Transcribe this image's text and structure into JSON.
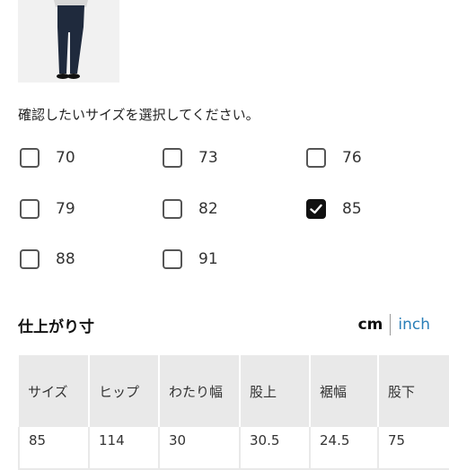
{
  "instruction": "確認したいサイズを選択してください。",
  "sizes": [
    {
      "label": "70",
      "checked": false
    },
    {
      "label": "73",
      "checked": false
    },
    {
      "label": "76",
      "checked": false
    },
    {
      "label": "79",
      "checked": false
    },
    {
      "label": "82",
      "checked": false
    },
    {
      "label": "85",
      "checked": true
    },
    {
      "label": "88",
      "checked": false
    },
    {
      "label": "91",
      "checked": false
    }
  ],
  "section_title": "仕上がり寸",
  "units": {
    "cm": "cm",
    "inch": "inch",
    "selected": "cm"
  },
  "table": {
    "headers": [
      "サイズ",
      "ヒップ",
      "わたり幅",
      "股上",
      "裾幅",
      "股下"
    ],
    "rows": [
      [
        "85",
        "114",
        "30",
        "30.5",
        "24.5",
        "75"
      ]
    ]
  },
  "colors": {
    "accent_link": "#2a7fb8",
    "checked_fill": "#111111"
  }
}
